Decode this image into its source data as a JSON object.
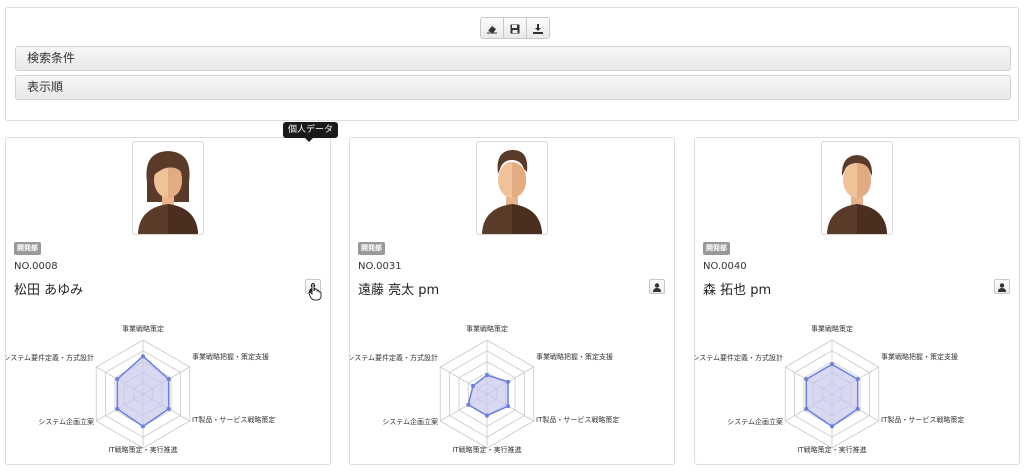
{
  "toolbar": {
    "buttons": [
      {
        "icon": "eraser-icon"
      },
      {
        "icon": "save-icon"
      },
      {
        "icon": "download-icon"
      }
    ]
  },
  "sections": {
    "search_conditions": "検索条件",
    "display_order": "表示順"
  },
  "tooltip": "個人データ",
  "radar_axes": [
    "事業戦略策定",
    "事業戦略把握・策定支援",
    "IT製品・サービス戦略策定",
    "IT戦略策定・実行推進",
    "システム企画立案",
    "システム要件定義・方式設計"
  ],
  "employees": [
    {
      "dept": "開発部",
      "no": "NO.0008",
      "name": "松田 あゆみ",
      "gender": "female",
      "skills": [
        0.7,
        0.55,
        0.55,
        0.6,
        0.55,
        0.55
      ]
    },
    {
      "dept": "開発部",
      "no": "NO.0031",
      "name": "遠藤 亮太 pm",
      "gender": "male",
      "skills": [
        0.35,
        0.45,
        0.45,
        0.4,
        0.4,
        0.3
      ]
    },
    {
      "dept": "開発部",
      "no": "NO.0040",
      "name": "森 拓也 pm",
      "gender": "male",
      "skills": [
        0.55,
        0.55,
        0.55,
        0.6,
        0.55,
        0.55
      ]
    }
  ],
  "colors": {
    "radar_fill": "#c8c8ee",
    "radar_stroke": "#6b7fe0",
    "grid": "#c8c8c8",
    "badge": "#999999"
  }
}
